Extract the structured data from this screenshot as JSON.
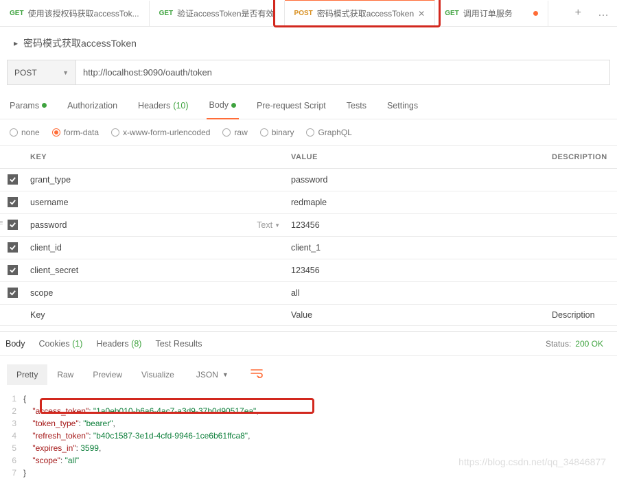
{
  "tabs": [
    {
      "method": "GET",
      "label": "使用该授权码获取accessTok..."
    },
    {
      "method": "GET",
      "label": "验证accessToken是否有效"
    },
    {
      "method": "POST",
      "label": "密码模式获取accessToken",
      "active": true,
      "closable": true
    },
    {
      "method": "GET",
      "label": "调用订单服务",
      "unsaved": true
    }
  ],
  "title": "密码模式获取accessToken",
  "request": {
    "method": "POST",
    "url": "http://localhost:9090/oauth/token"
  },
  "subtabs": {
    "params": "Params",
    "auth": "Authorization",
    "headers": "Headers",
    "headers_count": "(10)",
    "body": "Body",
    "preq": "Pre-request Script",
    "tests": "Tests",
    "settings": "Settings"
  },
  "body_types": {
    "none": "none",
    "formdata": "form-data",
    "xwww": "x-www-form-urlencoded",
    "raw": "raw",
    "binary": "binary",
    "graphql": "GraphQL"
  },
  "table": {
    "headers": {
      "key": "KEY",
      "value": "VALUE",
      "desc": "DESCRIPTION"
    },
    "rows": [
      {
        "key": "grant_type",
        "value": "password"
      },
      {
        "key": "username",
        "value": "redmaple"
      },
      {
        "key": "password",
        "value": "123456",
        "type": "Text"
      },
      {
        "key": "client_id",
        "value": "client_1"
      },
      {
        "key": "client_secret",
        "value": "123456"
      },
      {
        "key": "scope",
        "value": "all"
      }
    ],
    "placeholders": {
      "key": "Key",
      "value": "Value",
      "desc": "Description"
    }
  },
  "response_tabs": {
    "body": "Body",
    "cookies": "Cookies",
    "cookies_count": "(1)",
    "headers": "Headers",
    "headers_count": "(8)",
    "testresults": "Test Results"
  },
  "status": {
    "label": "Status:",
    "value": "200 OK"
  },
  "resp_controls": {
    "pretty": "Pretty",
    "raw": "Raw",
    "preview": "Preview",
    "visualize": "Visualize",
    "lang": "JSON"
  },
  "response_json": {
    "access_token": "1a0eb010-b6a6-4ac7-a3d9-37b0d90517ea",
    "token_type": "bearer",
    "refresh_token": "b40c1587-3e1d-4cfd-9946-1ce6b61ffca8",
    "expires_in": 3599,
    "scope": "all"
  },
  "watermark": "https://blog.csdn.net/qq_34846877"
}
